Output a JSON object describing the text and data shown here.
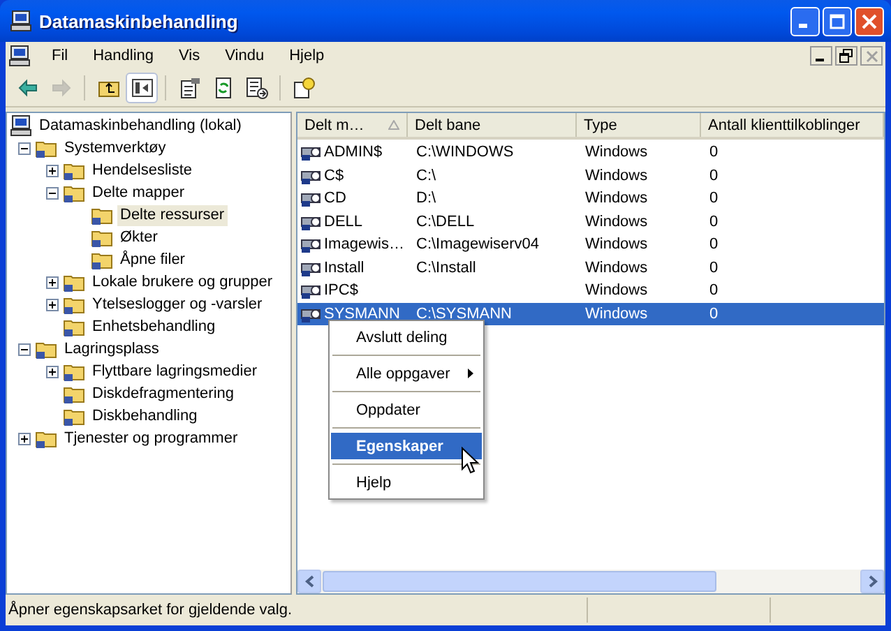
{
  "window": {
    "title": "Datamaskinbehandling"
  },
  "menu": [
    "Fil",
    "Handling",
    "Vis",
    "Vindu",
    "Hjelp"
  ],
  "toolbar": [
    {
      "kind": "back",
      "pressed": false,
      "disabled": false
    },
    {
      "kind": "forward",
      "pressed": false,
      "disabled": true
    },
    {
      "kind": "separator"
    },
    {
      "kind": "up",
      "pressed": false,
      "disabled": false
    },
    {
      "kind": "tree",
      "pressed": true,
      "disabled": false
    },
    {
      "kind": "separator"
    },
    {
      "kind": "properties",
      "pressed": false,
      "disabled": false
    },
    {
      "kind": "refresh",
      "pressed": false,
      "disabled": false
    },
    {
      "kind": "export",
      "pressed": false,
      "disabled": false
    },
    {
      "kind": "separator"
    },
    {
      "kind": "help",
      "pressed": false,
      "disabled": false
    }
  ],
  "tree": {
    "items": [
      {
        "label": "Datamaskinbehandling (lokal)",
        "selected": false,
        "children": [
          {
            "label": "Systemverktøy",
            "expanded": true,
            "selected": false,
            "children": [
              {
                "label": "Hendelsesliste",
                "expanded": false,
                "selected": false
              },
              {
                "label": "Delte mapper",
                "expanded": true,
                "selected": false,
                "children": [
                  {
                    "label": "Delte ressurser",
                    "selected": true
                  },
                  {
                    "label": "Økter",
                    "selected": false
                  },
                  {
                    "label": "Åpne filer",
                    "selected": false
                  }
                ]
              },
              {
                "label": "Lokale brukere og grupper",
                "expanded": false,
                "selected": false
              },
              {
                "label": "Ytelseslogger og -varsler",
                "expanded": false,
                "selected": false
              },
              {
                "label": "Enhetsbehandling",
                "selected": false
              }
            ]
          },
          {
            "label": "Lagringsplass",
            "expanded": true,
            "selected": false,
            "children": [
              {
                "label": "Flyttbare lagringsmedier",
                "expanded": false,
                "selected": false
              },
              {
                "label": "Diskdefragmentering",
                "selected": false
              },
              {
                "label": "Diskbehandling",
                "selected": false
              }
            ]
          },
          {
            "label": "Tjenester og programmer",
            "expanded": false,
            "selected": false
          }
        ]
      }
    ]
  },
  "table": {
    "columns": [
      {
        "label": "Delt m…",
        "sorted": true
      },
      {
        "label": "Delt bane",
        "sorted": false
      },
      {
        "label": "Type",
        "sorted": false
      },
      {
        "label": "Antall klienttilkoblinger",
        "sorted": false
      }
    ],
    "rows": [
      {
        "name": "ADMIN$",
        "path": "C:\\WINDOWS",
        "type": "Windows",
        "connections": "0",
        "selected": false
      },
      {
        "name": "C$",
        "path": "C:\\",
        "type": "Windows",
        "connections": "0",
        "selected": false
      },
      {
        "name": "CD",
        "path": "D:\\",
        "type": "Windows",
        "connections": "0",
        "selected": false
      },
      {
        "name": "DELL",
        "path": "C:\\DELL",
        "type": "Windows",
        "connections": "0",
        "selected": false
      },
      {
        "name": "Imagewis…",
        "path": "C:\\Imagewiserv04",
        "type": "Windows",
        "connections": "0",
        "selected": false
      },
      {
        "name": "Install",
        "path": "C:\\Install",
        "type": "Windows",
        "connections": "0",
        "selected": false
      },
      {
        "name": "IPC$",
        "type": "Windows",
        "connections": "0",
        "selected": false
      },
      {
        "name": "SYSMANN",
        "path": "C:\\SYSMANN",
        "type": "Windows",
        "connections": "0",
        "selected": true
      }
    ]
  },
  "context_menu": {
    "items": [
      {
        "label": "Avslutt deling",
        "submenu": false,
        "selected": false
      },
      {
        "label": "Alle oppgaver",
        "submenu": true,
        "selected": false
      },
      {
        "label": "Oppdater",
        "submenu": false,
        "selected": false
      },
      {
        "label": "Egenskaper",
        "submenu": false,
        "selected": true
      },
      {
        "label": "Hjelp",
        "submenu": false,
        "selected": false
      }
    ]
  },
  "status_bar": {
    "text": "Åpner egenskapsarket for gjeldende valg."
  }
}
